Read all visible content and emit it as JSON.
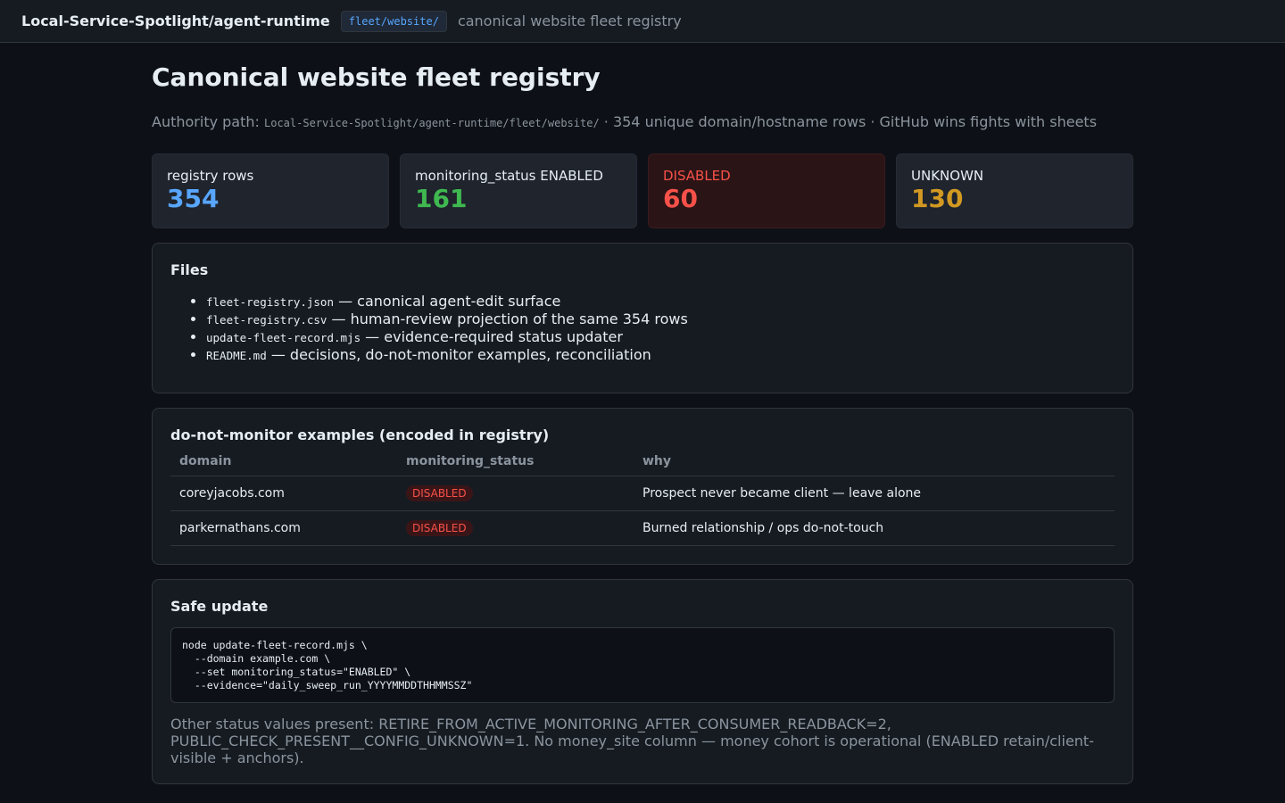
{
  "topbar": {
    "repo": "Local-Service-Spotlight/agent-runtime",
    "path_chip": "fleet/website/",
    "description": "canonical website fleet registry"
  },
  "page": {
    "title": "Canonical website fleet registry",
    "subtitle_prefix": "Authority path: ",
    "subtitle_path": "Local-Service-Spotlight/agent-runtime/fleet/website/",
    "subtitle_suffix": " · 354 unique domain/hostname rows · GitHub wins fights with sheets"
  },
  "stats": [
    {
      "label": "registry rows",
      "value": "354",
      "color": "#58a6ff"
    },
    {
      "label": "monitoring_status ENABLED",
      "value": "161",
      "color": "#3fb950"
    },
    {
      "label": "DISABLED",
      "value": "60",
      "color": "#f85149"
    },
    {
      "label": "UNKNOWN",
      "value": "130",
      "color": "#d29922"
    }
  ],
  "files": {
    "title": "Files",
    "items": [
      {
        "name": "fleet-registry.json",
        "desc": " — canonical agent-edit surface"
      },
      {
        "name": "fleet-registry.csv",
        "desc": " — human-review projection of the same 354 rows"
      },
      {
        "name": "update-fleet-record.mjs",
        "desc": " — evidence-required status updater"
      },
      {
        "name": "README.md",
        "desc": " — decisions, do-not-monitor examples, reconciliation"
      }
    ]
  },
  "do_not_monitor": {
    "title": "do-not-monitor examples (encoded in registry)",
    "headers": [
      "domain",
      "monitoring_status",
      "why"
    ],
    "rows": [
      {
        "domain": "coreyjacobs.com",
        "status": "DISABLED",
        "why": "Prospect never became client — leave alone"
      },
      {
        "domain": "parkernathans.com",
        "status": "DISABLED",
        "why": "Burned relationship / ops do-not-touch"
      }
    ]
  },
  "safe_update": {
    "title": "Safe update",
    "code": "node update-fleet-record.mjs \\\n  --domain example.com \\\n  --set monitoring_status=\"ENABLED\" \\\n  --evidence=\"daily_sweep_run_YYYYMMDDTHHMMSSZ\"",
    "note": "Other status values present: RETIRE_FROM_ACTIVE_MONITORING_AFTER_CONSUMER_READBACK=2, PUBLIC_CHECK_PRESENT__CONFIG_UNKNOWN=1. No money_site column — money cohort is operational (ENABLED retain/client-visible + anchors)."
  }
}
